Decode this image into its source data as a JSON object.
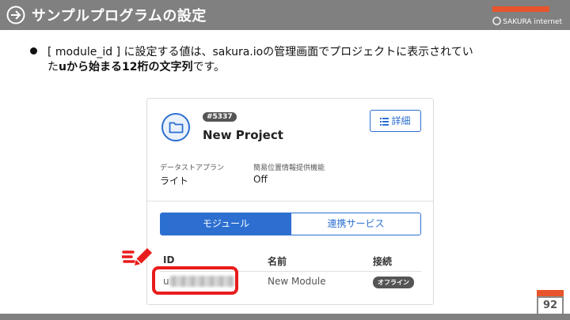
{
  "slide": {
    "title": "サンプルプログラムの設定",
    "page_number": "92"
  },
  "logo": {
    "text": "SAKURA internet"
  },
  "bullet": {
    "line1": "[ module_id ] に設定する値は、sakura.ioの管理画面でプロジェクトに表示されてい",
    "line2_prefix": "た",
    "line2_bold": "uから始まる12桁の文字列",
    "line2_suffix": "です。"
  },
  "card": {
    "project_id": "#5337",
    "project_name": "New Project",
    "detail_button": "詳細",
    "data_plan_label": "データストアプラン",
    "data_plan_value": "ライト",
    "location_label": "簡易位置情報提供機能",
    "location_value": "Off",
    "tabs": [
      {
        "label": "モジュール",
        "active": true
      },
      {
        "label": "連携サービス",
        "active": false
      }
    ],
    "table": {
      "headers": [
        "ID",
        "名前",
        "接続"
      ],
      "rows": [
        {
          "id_prefix": "u",
          "name": "New Module",
          "status": "オフライン"
        }
      ]
    }
  },
  "colors": {
    "accent": "#2c6fd1",
    "brand": "#e8542b",
    "highlight": "#e81c1c",
    "title_bar": "#808080"
  },
  "icons": [
    "arrow-right-icon",
    "folder-icon",
    "list-icon",
    "edit-icon"
  ]
}
